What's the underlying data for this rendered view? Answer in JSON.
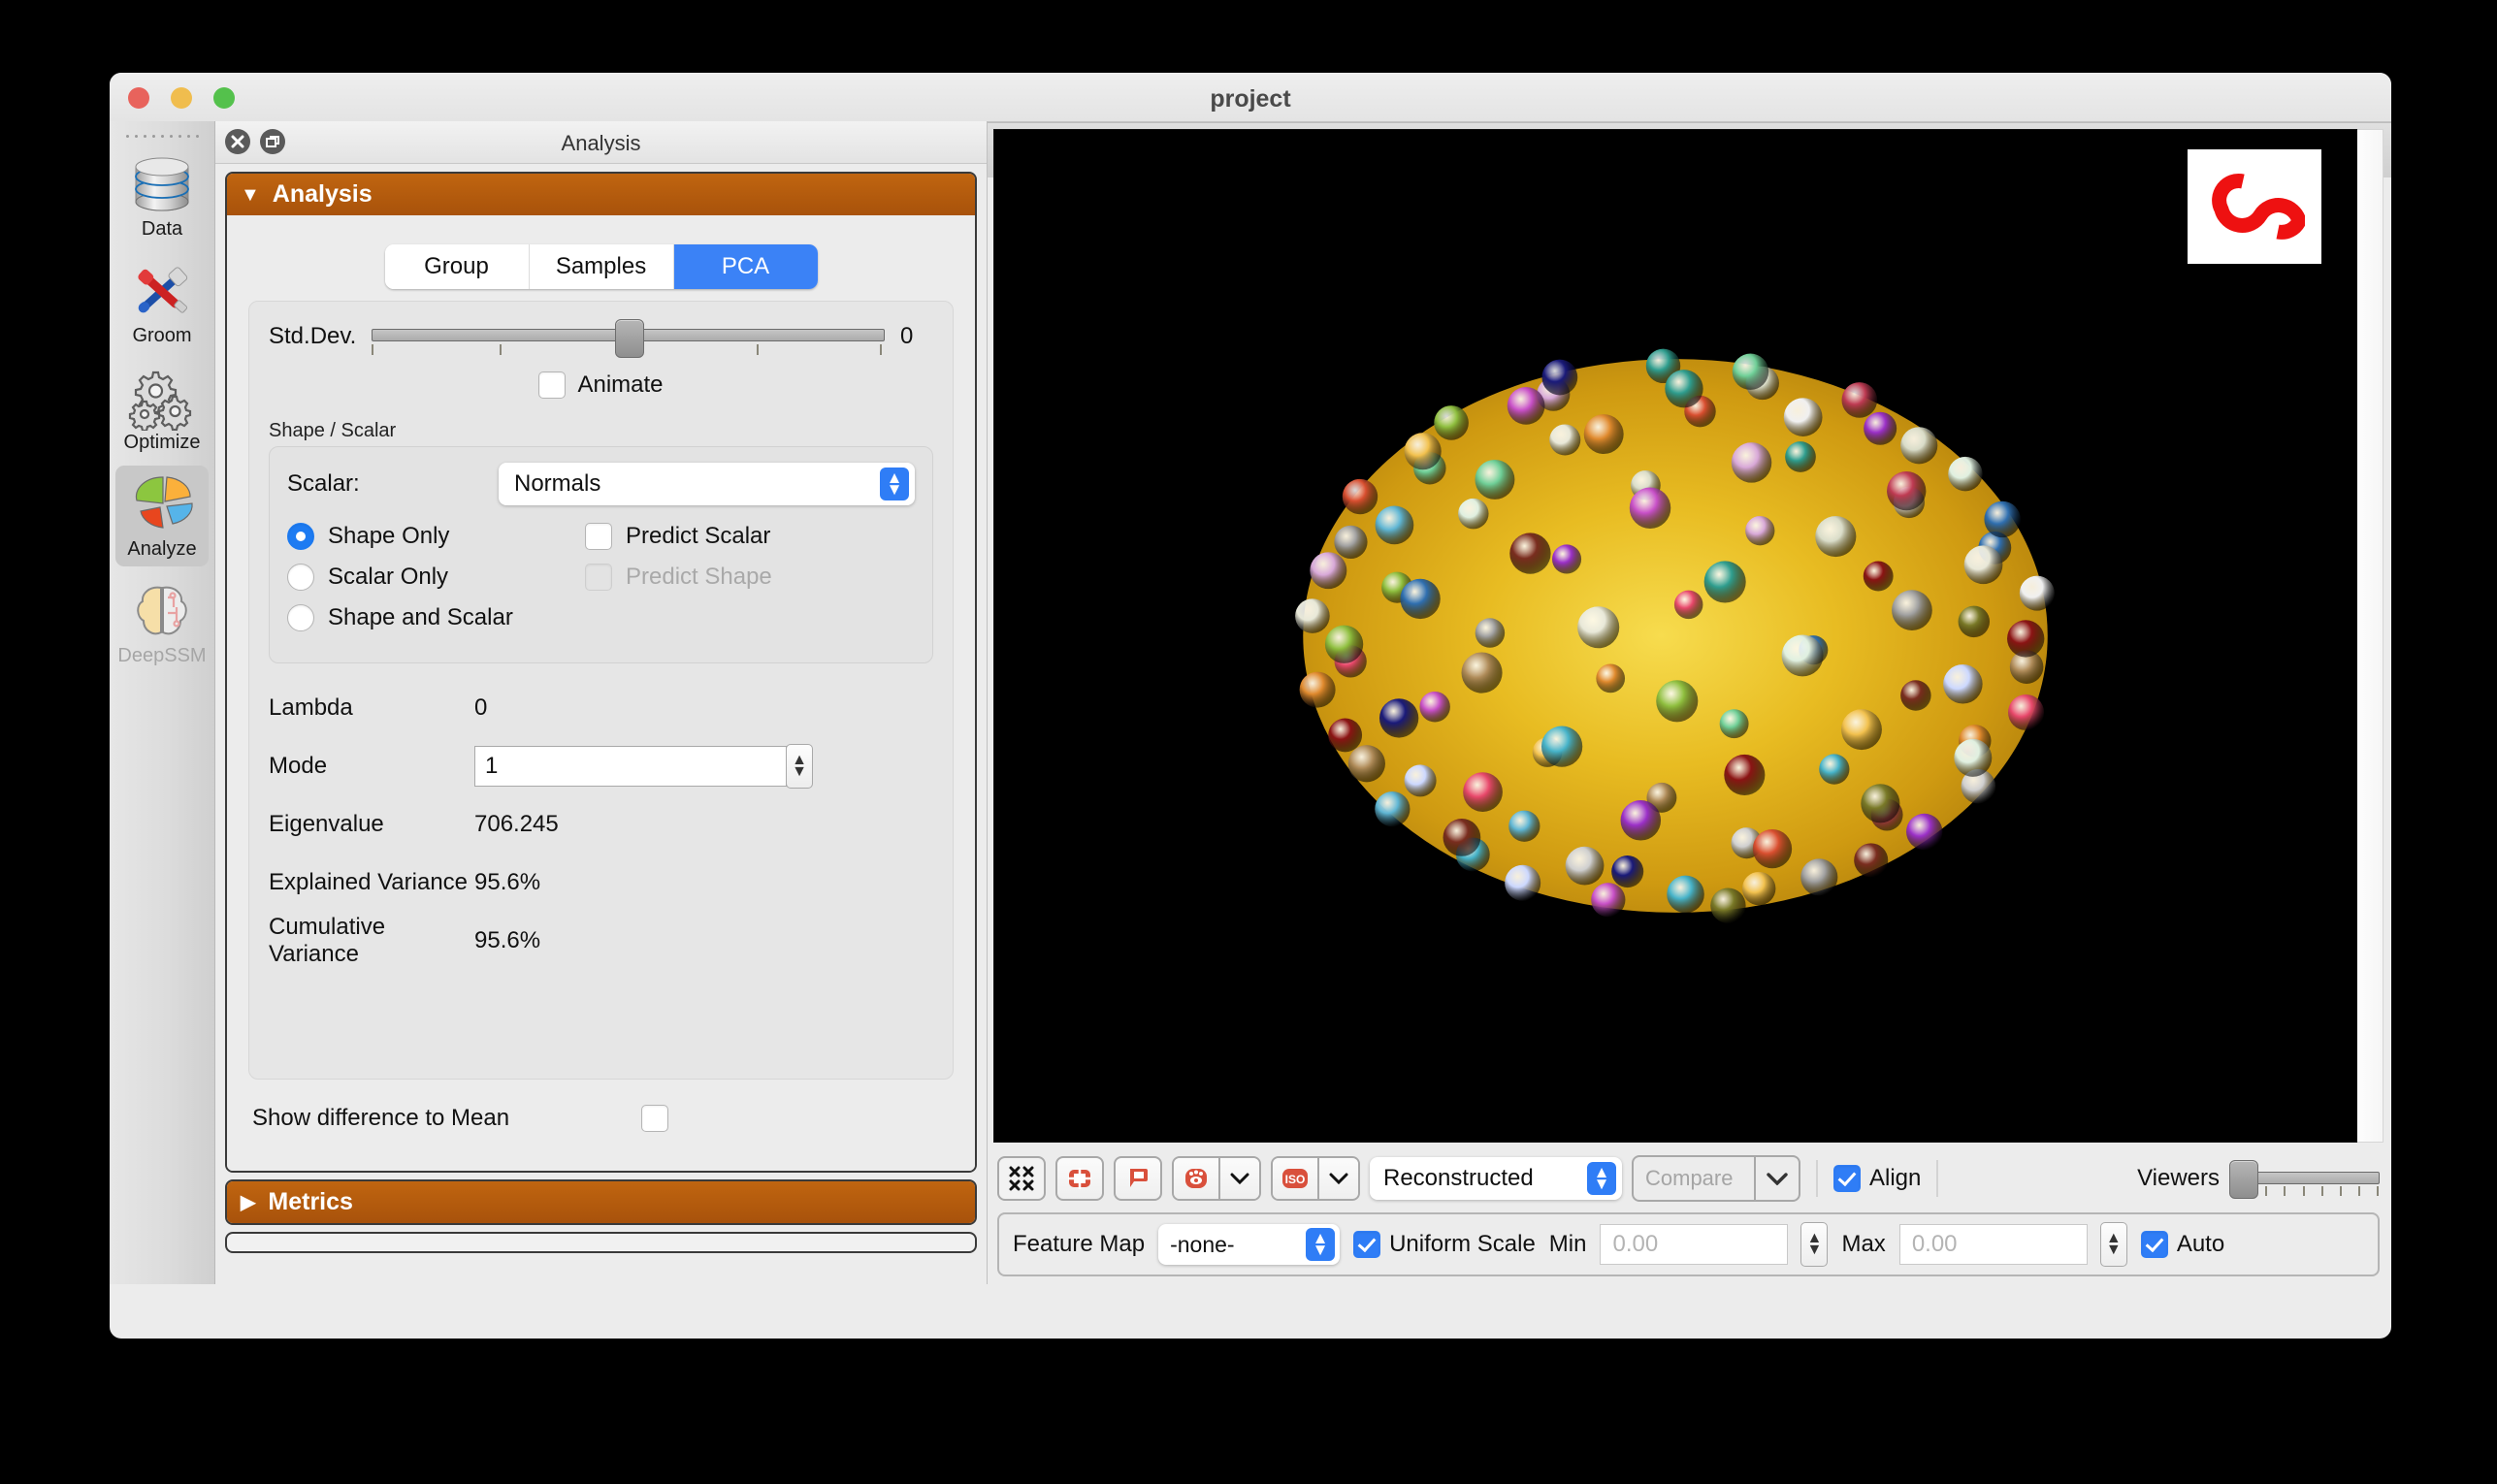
{
  "window": {
    "title": "project",
    "traffic_lights": [
      "close",
      "minimize",
      "zoom"
    ]
  },
  "sidebar": {
    "items": [
      {
        "label": "Data",
        "icon": "database-icon",
        "selected": false,
        "disabled": false
      },
      {
        "label": "Groom",
        "icon": "tools-icon",
        "selected": false,
        "disabled": false
      },
      {
        "label": "Optimize",
        "icon": "gears-icon",
        "selected": false,
        "disabled": false
      },
      {
        "label": "Analyze",
        "icon": "pie-chart-icon",
        "selected": true,
        "disabled": false
      },
      {
        "label": "DeepSSM",
        "icon": "brain-icon",
        "selected": false,
        "disabled": true
      }
    ]
  },
  "dock": {
    "title": "Analysis",
    "close_icon": "close-icon",
    "float_icon": "float-window-icon"
  },
  "analysis_panel": {
    "header": "Analysis",
    "expanded": true,
    "tabs": [
      {
        "label": "Group",
        "active": false
      },
      {
        "label": "Samples",
        "active": false
      },
      {
        "label": "PCA",
        "active": true
      }
    ],
    "std_dev": {
      "label": "Std.Dev.",
      "value": "0",
      "knob_percent": 50,
      "tick_count": 5
    },
    "animate": {
      "label": "Animate",
      "checked": false
    },
    "shape_scalar": {
      "legend": "Shape / Scalar",
      "scalar_label": "Scalar:",
      "scalar_value": "Normals",
      "radios": [
        {
          "label": "Shape Only",
          "selected": true
        },
        {
          "label": "Scalar Only",
          "selected": false
        },
        {
          "label": "Shape and Scalar",
          "selected": false
        }
      ],
      "checkboxes": [
        {
          "label": "Predict Scalar",
          "checked": false,
          "disabled": false
        },
        {
          "label": "Predict Shape",
          "checked": false,
          "disabled": true
        }
      ]
    },
    "stats": [
      {
        "key": "Lambda",
        "value": "0"
      },
      {
        "key": "Mode",
        "value": "1",
        "is_spinbox": true
      },
      {
        "key": "Eigenvalue",
        "value": "706.245"
      },
      {
        "key": "Explained Variance",
        "value": "95.6%"
      },
      {
        "key": "Cumulative Variance",
        "value": "95.6%"
      }
    ],
    "show_difference": {
      "label": "Show difference to Mean",
      "checked": false
    }
  },
  "metrics_panel": {
    "header": "Metrics",
    "expanded": false
  },
  "viewer": {
    "background": "#000000",
    "logo": {
      "name": "shapeworks-logo",
      "color": "#ee1111"
    },
    "shape": {
      "name": "ellipsoid-mesh",
      "surface_color": "#d9a21a",
      "highlight_color": "#f6d84f",
      "particle_count": 96
    }
  },
  "viewer_toolbar": {
    "buttons": [
      {
        "name": "autofit-icon",
        "label": "autofit"
      },
      {
        "name": "reset-view-icon",
        "label": "reset view"
      },
      {
        "name": "plane-flag-icon",
        "label": "planes"
      },
      {
        "name": "show-glyphs-icon",
        "label": "glyphs",
        "has_dropdown": true
      },
      {
        "name": "iso-view-icon",
        "label": "ISO",
        "has_dropdown": true
      }
    ],
    "display_mode": {
      "value": "Reconstructed"
    },
    "compare": {
      "value": "Compare",
      "disabled": true
    },
    "align": {
      "label": "Align",
      "checked": true
    },
    "viewers": {
      "label": "Viewers",
      "knob_percent": 0,
      "tick_count": 8
    }
  },
  "feature_bar": {
    "feature_map_label": "Feature Map",
    "feature_map_value": "-none-",
    "uniform_scale": {
      "label": "Uniform Scale",
      "checked": true
    },
    "min": {
      "label": "Min",
      "value": "0.00"
    },
    "max": {
      "label": "Max",
      "value": "0.00"
    },
    "auto": {
      "label": "Auto",
      "checked": true
    }
  },
  "status_bar": {
    "icon": "document-icon"
  }
}
